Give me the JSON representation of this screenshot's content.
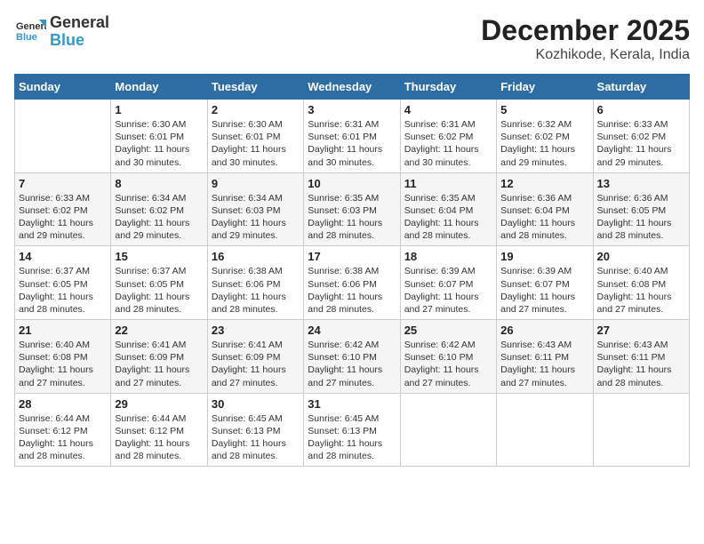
{
  "logo": {
    "text1": "General",
    "text2": "Blue"
  },
  "title": "December 2025",
  "subtitle": "Kozhikode, Kerala, India",
  "days_of_week": [
    "Sunday",
    "Monday",
    "Tuesday",
    "Wednesday",
    "Thursday",
    "Friday",
    "Saturday"
  ],
  "weeks": [
    [
      {
        "day": "",
        "sunrise": "",
        "sunset": "",
        "daylight": ""
      },
      {
        "day": "1",
        "sunrise": "Sunrise: 6:30 AM",
        "sunset": "Sunset: 6:01 PM",
        "daylight": "Daylight: 11 hours and 30 minutes."
      },
      {
        "day": "2",
        "sunrise": "Sunrise: 6:30 AM",
        "sunset": "Sunset: 6:01 PM",
        "daylight": "Daylight: 11 hours and 30 minutes."
      },
      {
        "day": "3",
        "sunrise": "Sunrise: 6:31 AM",
        "sunset": "Sunset: 6:01 PM",
        "daylight": "Daylight: 11 hours and 30 minutes."
      },
      {
        "day": "4",
        "sunrise": "Sunrise: 6:31 AM",
        "sunset": "Sunset: 6:02 PM",
        "daylight": "Daylight: 11 hours and 30 minutes."
      },
      {
        "day": "5",
        "sunrise": "Sunrise: 6:32 AM",
        "sunset": "Sunset: 6:02 PM",
        "daylight": "Daylight: 11 hours and 29 minutes."
      },
      {
        "day": "6",
        "sunrise": "Sunrise: 6:33 AM",
        "sunset": "Sunset: 6:02 PM",
        "daylight": "Daylight: 11 hours and 29 minutes."
      }
    ],
    [
      {
        "day": "7",
        "sunrise": "Sunrise: 6:33 AM",
        "sunset": "Sunset: 6:02 PM",
        "daylight": "Daylight: 11 hours and 29 minutes."
      },
      {
        "day": "8",
        "sunrise": "Sunrise: 6:34 AM",
        "sunset": "Sunset: 6:02 PM",
        "daylight": "Daylight: 11 hours and 29 minutes."
      },
      {
        "day": "9",
        "sunrise": "Sunrise: 6:34 AM",
        "sunset": "Sunset: 6:03 PM",
        "daylight": "Daylight: 11 hours and 29 minutes."
      },
      {
        "day": "10",
        "sunrise": "Sunrise: 6:35 AM",
        "sunset": "Sunset: 6:03 PM",
        "daylight": "Daylight: 11 hours and 28 minutes."
      },
      {
        "day": "11",
        "sunrise": "Sunrise: 6:35 AM",
        "sunset": "Sunset: 6:04 PM",
        "daylight": "Daylight: 11 hours and 28 minutes."
      },
      {
        "day": "12",
        "sunrise": "Sunrise: 6:36 AM",
        "sunset": "Sunset: 6:04 PM",
        "daylight": "Daylight: 11 hours and 28 minutes."
      },
      {
        "day": "13",
        "sunrise": "Sunrise: 6:36 AM",
        "sunset": "Sunset: 6:05 PM",
        "daylight": "Daylight: 11 hours and 28 minutes."
      }
    ],
    [
      {
        "day": "14",
        "sunrise": "Sunrise: 6:37 AM",
        "sunset": "Sunset: 6:05 PM",
        "daylight": "Daylight: 11 hours and 28 minutes."
      },
      {
        "day": "15",
        "sunrise": "Sunrise: 6:37 AM",
        "sunset": "Sunset: 6:05 PM",
        "daylight": "Daylight: 11 hours and 28 minutes."
      },
      {
        "day": "16",
        "sunrise": "Sunrise: 6:38 AM",
        "sunset": "Sunset: 6:06 PM",
        "daylight": "Daylight: 11 hours and 28 minutes."
      },
      {
        "day": "17",
        "sunrise": "Sunrise: 6:38 AM",
        "sunset": "Sunset: 6:06 PM",
        "daylight": "Daylight: 11 hours and 28 minutes."
      },
      {
        "day": "18",
        "sunrise": "Sunrise: 6:39 AM",
        "sunset": "Sunset: 6:07 PM",
        "daylight": "Daylight: 11 hours and 27 minutes."
      },
      {
        "day": "19",
        "sunrise": "Sunrise: 6:39 AM",
        "sunset": "Sunset: 6:07 PM",
        "daylight": "Daylight: 11 hours and 27 minutes."
      },
      {
        "day": "20",
        "sunrise": "Sunrise: 6:40 AM",
        "sunset": "Sunset: 6:08 PM",
        "daylight": "Daylight: 11 hours and 27 minutes."
      }
    ],
    [
      {
        "day": "21",
        "sunrise": "Sunrise: 6:40 AM",
        "sunset": "Sunset: 6:08 PM",
        "daylight": "Daylight: 11 hours and 27 minutes."
      },
      {
        "day": "22",
        "sunrise": "Sunrise: 6:41 AM",
        "sunset": "Sunset: 6:09 PM",
        "daylight": "Daylight: 11 hours and 27 minutes."
      },
      {
        "day": "23",
        "sunrise": "Sunrise: 6:41 AM",
        "sunset": "Sunset: 6:09 PM",
        "daylight": "Daylight: 11 hours and 27 minutes."
      },
      {
        "day": "24",
        "sunrise": "Sunrise: 6:42 AM",
        "sunset": "Sunset: 6:10 PM",
        "daylight": "Daylight: 11 hours and 27 minutes."
      },
      {
        "day": "25",
        "sunrise": "Sunrise: 6:42 AM",
        "sunset": "Sunset: 6:10 PM",
        "daylight": "Daylight: 11 hours and 27 minutes."
      },
      {
        "day": "26",
        "sunrise": "Sunrise: 6:43 AM",
        "sunset": "Sunset: 6:11 PM",
        "daylight": "Daylight: 11 hours and 27 minutes."
      },
      {
        "day": "27",
        "sunrise": "Sunrise: 6:43 AM",
        "sunset": "Sunset: 6:11 PM",
        "daylight": "Daylight: 11 hours and 28 minutes."
      }
    ],
    [
      {
        "day": "28",
        "sunrise": "Sunrise: 6:44 AM",
        "sunset": "Sunset: 6:12 PM",
        "daylight": "Daylight: 11 hours and 28 minutes."
      },
      {
        "day": "29",
        "sunrise": "Sunrise: 6:44 AM",
        "sunset": "Sunset: 6:12 PM",
        "daylight": "Daylight: 11 hours and 28 minutes."
      },
      {
        "day": "30",
        "sunrise": "Sunrise: 6:45 AM",
        "sunset": "Sunset: 6:13 PM",
        "daylight": "Daylight: 11 hours and 28 minutes."
      },
      {
        "day": "31",
        "sunrise": "Sunrise: 6:45 AM",
        "sunset": "Sunset: 6:13 PM",
        "daylight": "Daylight: 11 hours and 28 minutes."
      },
      {
        "day": "",
        "sunrise": "",
        "sunset": "",
        "daylight": ""
      },
      {
        "day": "",
        "sunrise": "",
        "sunset": "",
        "daylight": ""
      },
      {
        "day": "",
        "sunrise": "",
        "sunset": "",
        "daylight": ""
      }
    ]
  ]
}
